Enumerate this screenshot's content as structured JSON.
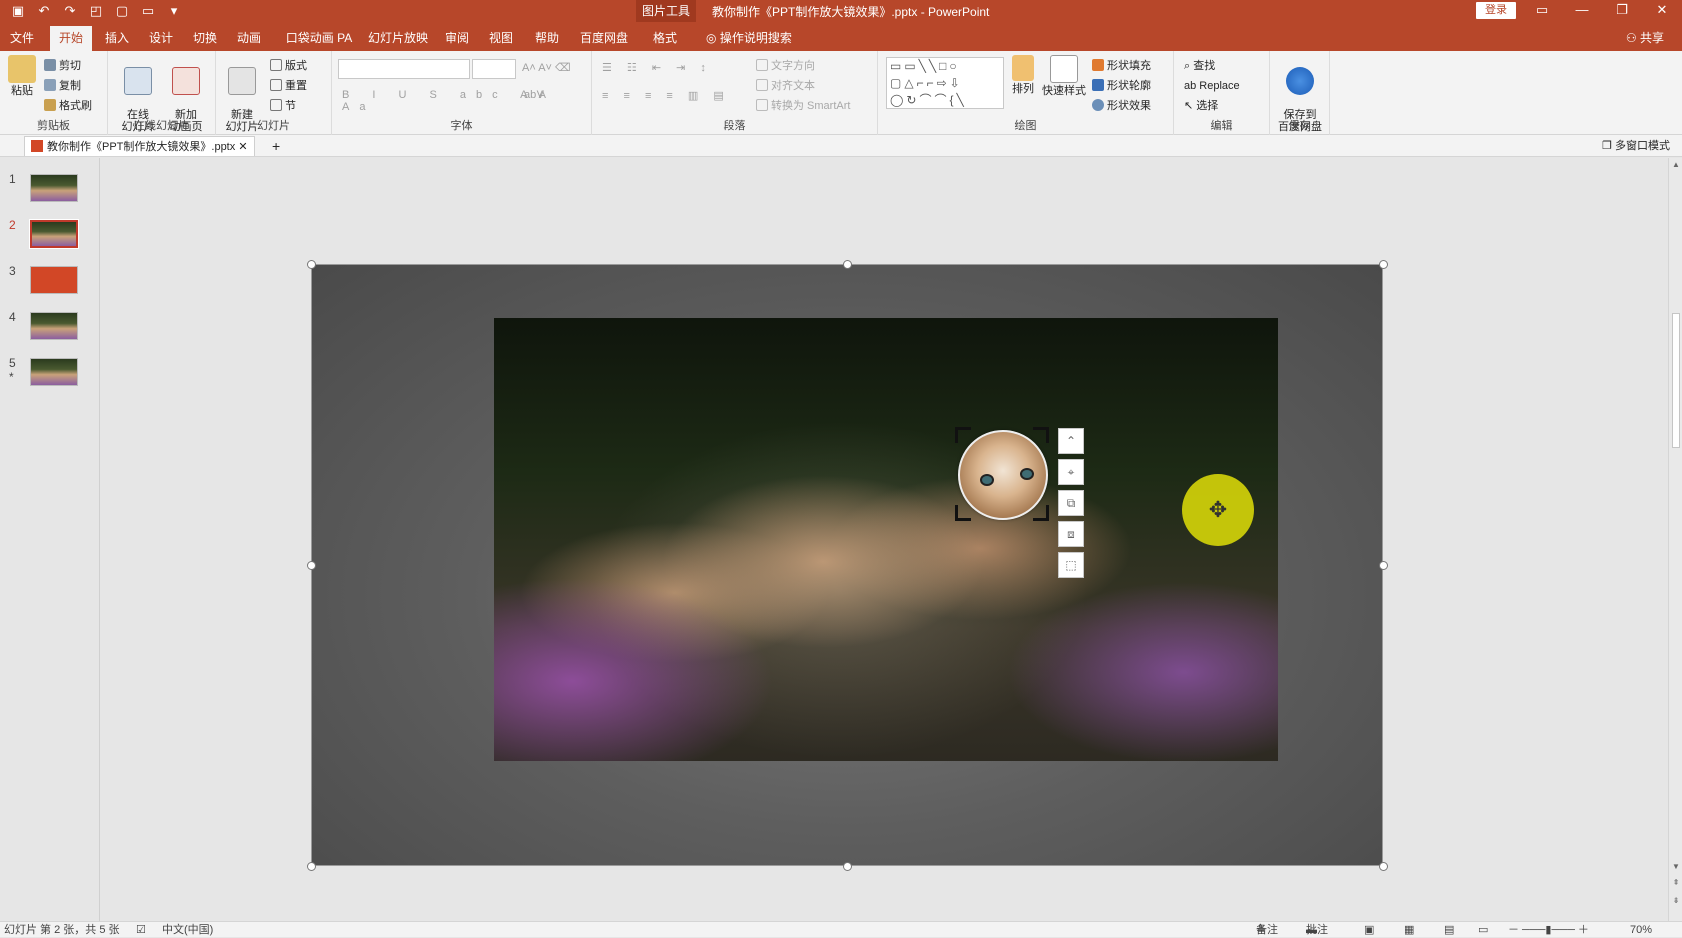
{
  "titlebar": {
    "context_tool": "图片工具",
    "document_title": "教你制作《PPT制作放大镜效果》.pptx - PowerPoint",
    "login": "登录",
    "qat_icons": [
      "save-icon",
      "undo-icon",
      "redo-icon",
      "presenter-icon",
      "new-file-icon",
      "open-folder-icon",
      "customize-icon"
    ]
  },
  "tabs": {
    "items": [
      "文件",
      "开始",
      "插入",
      "设计",
      "切换",
      "动画",
      "口袋动画 PA",
      "幻灯片放映",
      "审阅",
      "视图",
      "帮助",
      "百度网盘",
      "格式"
    ],
    "active": "开始",
    "search": "操作说明搜索",
    "share": "共享"
  },
  "ribbon": {
    "clipboard": {
      "paste": "粘贴",
      "cut": "剪切",
      "copy": "复制",
      "format_painter": "格式刷",
      "label": "剪贴板"
    },
    "online_slides": {
      "online": "在线\n幻灯片",
      "new_anim": "新加\n动画页",
      "label": "在线幻灯片"
    },
    "slides": {
      "new_slide": "新建\n幻灯片",
      "layout": "版式",
      "reset": "重置",
      "section": "节",
      "label": "幻灯片"
    },
    "font": {
      "label": "字体"
    },
    "paragraph": {
      "text_direction": "文字方向",
      "align_text": "对齐文本",
      "smartart": "转换为 SmartArt",
      "label": "段落"
    },
    "drawing": {
      "arrange": "排列",
      "quick_styles": "快速样式",
      "shape_fill": "形状填充",
      "shape_outline": "形状轮廓",
      "shape_effects": "形状效果",
      "label": "绘图"
    },
    "editing": {
      "find": "查找",
      "replace": "Replace",
      "select": "选择",
      "label": "编辑"
    },
    "save": {
      "save_to_pan": "保存到\n百度网盘",
      "label": "保存"
    }
  },
  "doc_tab": {
    "name": "教你制作《PPT制作放大镜效果》.pptx",
    "multi_window": "多窗口模式"
  },
  "thumbnails": [
    {
      "num": "1",
      "style": "cats"
    },
    {
      "num": "2",
      "style": "cats",
      "active": true
    },
    {
      "num": "3",
      "style": "red"
    },
    {
      "num": "4",
      "style": "cats"
    },
    {
      "num": "5",
      "style": "cats",
      "star": "*"
    }
  ],
  "statusbar": {
    "slide_info": "幻灯片 第 2 张，共 5 张",
    "language": "中文(中国)",
    "notes": "备注",
    "comments": "批注",
    "zoom": "70%"
  },
  "colors": {
    "accent": "#b7472a",
    "cursor_highlight": "#d2d209"
  }
}
